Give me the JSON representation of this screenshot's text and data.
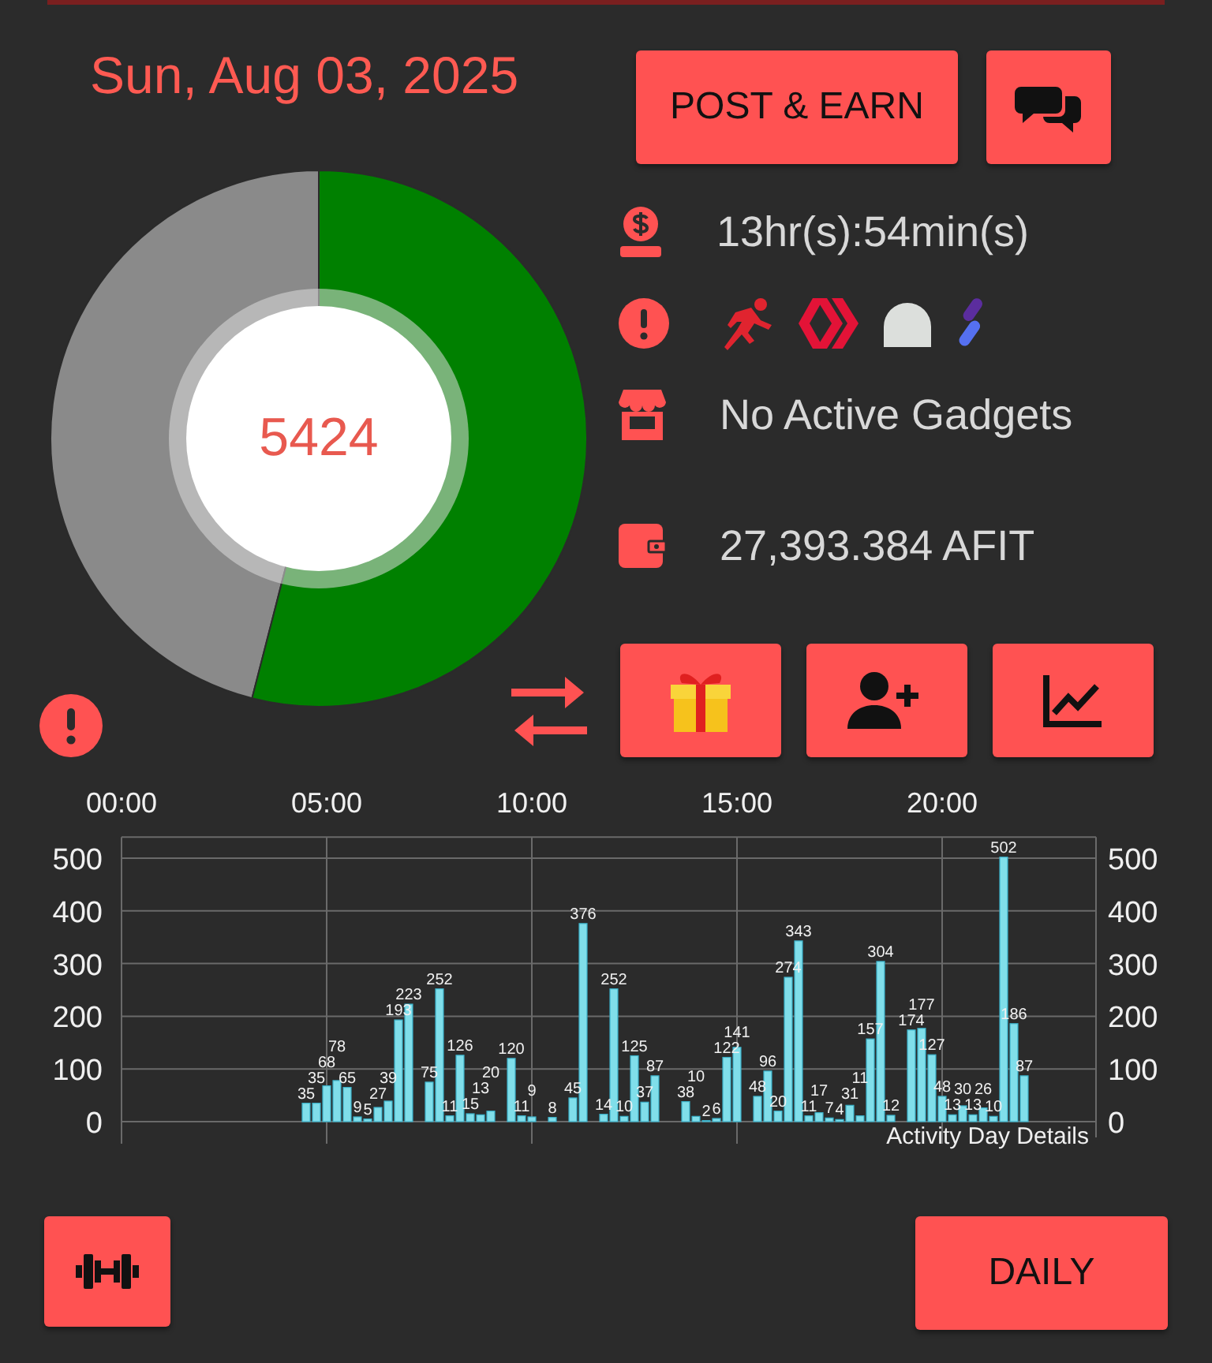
{
  "date": "Sun, Aug 03, 2025",
  "gauge": {
    "value": "5424"
  },
  "post_button": "POST & EARN",
  "info": {
    "countdown": "13hr(s):54min(s)",
    "gadgets": "No Active Gadgets",
    "balance": "27,393.384 AFIT"
  },
  "chart": {
    "chart_data": {
      "type": "bar",
      "title": "Activity Day Details",
      "data_labels": true,
      "grid": true,
      "xlim": [
        0,
        23.75
      ],
      "ylim": [
        0,
        540
      ],
      "xticks": [
        {
          "value": 0,
          "label": "00:00"
        },
        {
          "value": 5,
          "label": "05:00"
        },
        {
          "value": 10,
          "label": "10:00"
        },
        {
          "value": 15,
          "label": "15:00"
        },
        {
          "value": 20,
          "label": "20:00"
        }
      ],
      "yticks": [
        0,
        100,
        200,
        300,
        400,
        500
      ],
      "x": [
        4.5,
        4.75,
        5,
        5.25,
        5.5,
        5.75,
        6,
        6.25,
        6.5,
        6.75,
        7,
        7.5,
        7.75,
        8,
        8.25,
        8.5,
        8.75,
        9,
        9.5,
        9.75,
        10,
        10.5,
        11,
        11.25,
        11.75,
        12,
        12.25,
        12.5,
        12.75,
        13,
        13.75,
        14,
        14.25,
        14.5,
        14.75,
        15,
        15.5,
        15.75,
        16,
        16.25,
        16.5,
        16.75,
        17,
        17.25,
        17.5,
        17.75,
        18,
        18.25,
        18.5,
        18.75,
        19.25,
        19.5,
        19.75,
        20,
        20.25,
        20.5,
        20.75,
        21,
        21.25,
        21.5,
        21.75,
        22
      ],
      "values": [
        35,
        35,
        68,
        78,
        65,
        9,
        5,
        27,
        39,
        193,
        223,
        75,
        252,
        11,
        126,
        15,
        13,
        20,
        120,
        11,
        9,
        8,
        45,
        376,
        14,
        252,
        10,
        125,
        37,
        87,
        38,
        10,
        2,
        6,
        122,
        141,
        48,
        96,
        20,
        274,
        343,
        11,
        17,
        7,
        4,
        31,
        11,
        157,
        304,
        12,
        174,
        177,
        127,
        48,
        13,
        30,
        13,
        26,
        10,
        502,
        186,
        87
      ]
    },
    "left_axis": [
      "500",
      "400",
      "300",
      "200",
      "100",
      "0"
    ]
  },
  "daily_button": "DAILY"
}
